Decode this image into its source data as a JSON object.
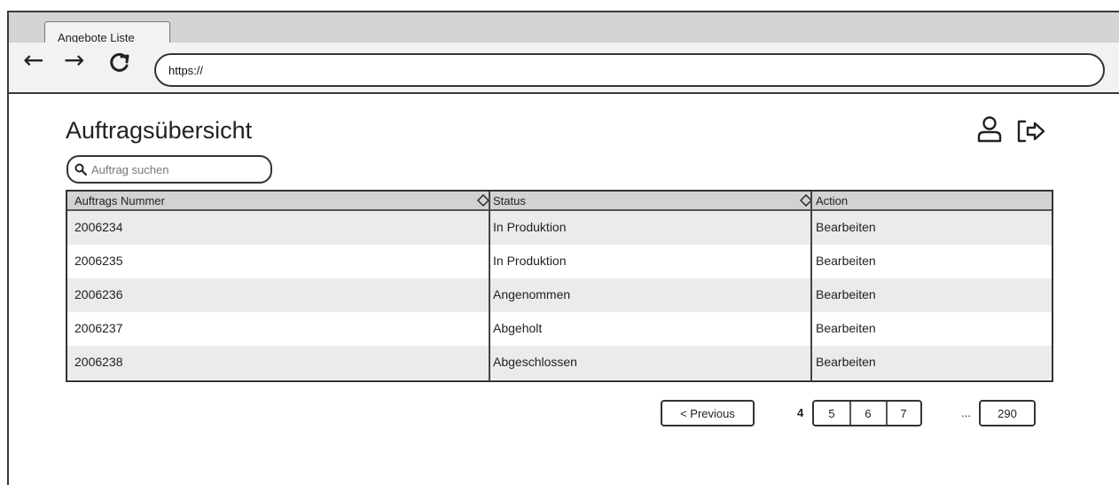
{
  "browser": {
    "tab_title": "Angebote Liste",
    "url": "https://",
    "back_glyph": "←",
    "forward_glyph": "→",
    "reload_glyph": "C"
  },
  "page": {
    "title": "Auftragsübersicht",
    "icons": [
      "user-icon",
      "logout-icon"
    ]
  },
  "search": {
    "placeholder": "Auftrag suchen"
  },
  "table": {
    "columns": [
      "Auftrags Nummer",
      "Status",
      "Action"
    ],
    "rows": [
      {
        "nummer": "2006234",
        "status": "In Produktion",
        "action": "Bearbeiten"
      },
      {
        "nummer": "2006235",
        "status": "In Produktion",
        "action": "Bearbeiten"
      },
      {
        "nummer": "2006236",
        "status": "Angenommen",
        "action": "Bearbeiten"
      },
      {
        "nummer": "2006237",
        "status": "Abgeholt",
        "action": "Bearbeiten"
      },
      {
        "nummer": "2006238",
        "status": "Abgeschlossen",
        "action": "Bearbeiten"
      }
    ]
  },
  "pagination": {
    "previous_label": "< Previous",
    "current_page": "4",
    "pages": [
      "5",
      "6",
      "7"
    ],
    "ellipsis": "...",
    "last_page": "290"
  }
}
